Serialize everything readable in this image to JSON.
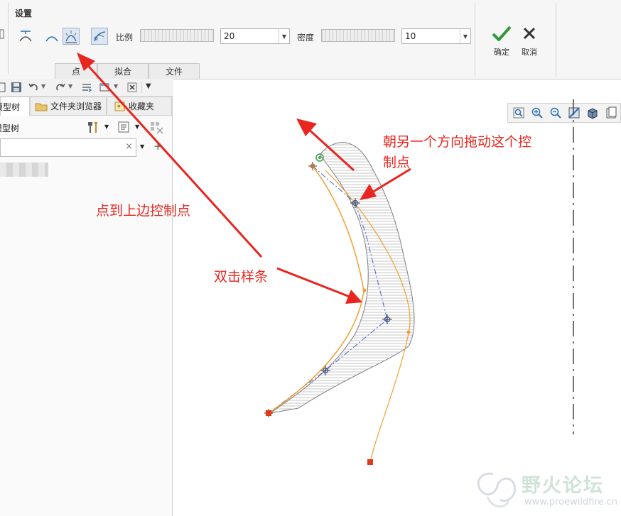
{
  "ribbon": {
    "group_title": "设置",
    "ratio_label": "比例",
    "ratio_value": "20",
    "density_label": "密度",
    "density_value": "10",
    "confirm_label": "确定",
    "cancel_label": "取消",
    "tabs": [
      "点",
      "拟合",
      "文件"
    ],
    "confirm_color": "#2e9a3a"
  },
  "left_panel": {
    "tabs": [
      "模型树",
      "文件夹浏览器",
      "收藏夹"
    ],
    "header_label": "模型树",
    "search_value": ""
  },
  "annotations": {
    "drag_text_line1": "朝另一个方向拖动这个控",
    "drag_text_line2": "制点",
    "click_text": "点到上边控制点",
    "double_click_text": "双击样条",
    "color": "#e8261f"
  },
  "watermark": {
    "title": "野火论坛",
    "url": "www.proewildfire.cn"
  }
}
